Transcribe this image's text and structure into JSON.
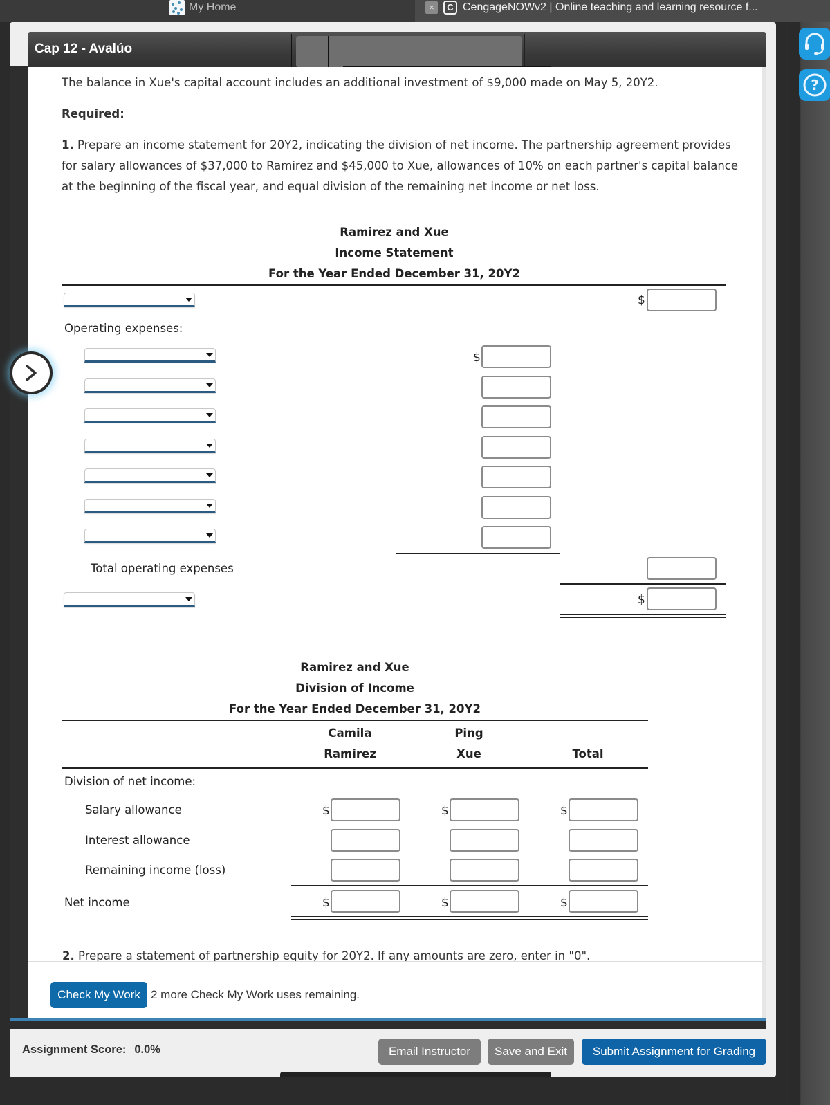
{
  "browser": {
    "tabs": [
      {
        "label": "My Home",
        "icon": "my-home-favicon"
      },
      {
        "label": "CengageNOWv2 | Online teaching and learning resource f...",
        "icon": "cengage-favicon",
        "close_icon": "×",
        "favicon_letter": "C"
      }
    ]
  },
  "assignment": {
    "title": "Cap 12 - Avalúo"
  },
  "rail": {
    "support_icon": "headset-icon",
    "help_icon": "question-circle-icon",
    "help_glyph": "?"
  },
  "question": {
    "intro": "The balance in Xue's capital account includes an additional investment of $9,000 made on May 5, 20Y2.",
    "required_label": "Required:",
    "step1_number": "1.",
    "step1_text": "Prepare an income statement for 20Y2, indicating the division of net income. The partnership agreement provides for salary allowances of $37,000 to Ramirez and $45,000 to Xue, allowances of 10% on each partner's capital balance at the beginning of the fiscal year, and equal division of the remaining net income or net loss.",
    "step2_number": "2.",
    "step2_text": "Prepare a statement of partnership equity for 20Y2. If any amounts are zero, enter in \"0\"."
  },
  "income_statement": {
    "company": "Ramirez and Xue",
    "title": "Income Statement",
    "period": "For the Year Ended December 31, 20Y2",
    "revenue_select": "",
    "revenue_value": "",
    "operating_expenses_label": "Operating expenses:",
    "expense_rows": [
      {
        "select": "",
        "value": ""
      },
      {
        "select": "",
        "value": ""
      },
      {
        "select": "",
        "value": ""
      },
      {
        "select": "",
        "value": ""
      },
      {
        "select": "",
        "value": ""
      },
      {
        "select": "",
        "value": ""
      },
      {
        "select": "",
        "value": ""
      }
    ],
    "total_operating_expenses_label": "Total operating expenses",
    "total_operating_expenses_value": "",
    "net_select": "",
    "net_value": "",
    "currency": "$"
  },
  "division_of_income": {
    "company": "Ramirez and Xue",
    "title": "Division of Income",
    "period": "For the Year Ended December 31, 20Y2",
    "columns": [
      {
        "line1": "Camila",
        "line2": "Ramirez"
      },
      {
        "line1": "Ping",
        "line2": "Xue"
      },
      {
        "line1": "",
        "line2": "Total"
      }
    ],
    "section_label": "Division of net income:",
    "rows": [
      {
        "label": "Salary allowance",
        "values": [
          "",
          "",
          ""
        ],
        "dollar": true
      },
      {
        "label": "Interest allowance",
        "values": [
          "",
          "",
          ""
        ],
        "dollar": false
      },
      {
        "label": "Remaining income (loss)",
        "values": [
          "",
          "",
          ""
        ],
        "dollar": false
      }
    ],
    "net_income_label": "Net income",
    "net_income_values": [
      "",
      "",
      ""
    ],
    "currency": "$"
  },
  "check_work": {
    "button_label": "Check My Work",
    "note": "2 more Check My Work uses remaining."
  },
  "footer": {
    "score_label": "Assignment Score:",
    "score_value": "0.0%",
    "email_label": "Email Instructor",
    "save_label": "Save and Exit",
    "submit_label": "Submit Assignment for Grading"
  },
  "nav": {
    "next_icon": "chevron-right-icon"
  },
  "colors": {
    "primary_button": "#0e6aa9",
    "secondary_button": "#7d7d7d",
    "rail_button": "#1f9be0",
    "select_underline": "#2c5b82"
  }
}
